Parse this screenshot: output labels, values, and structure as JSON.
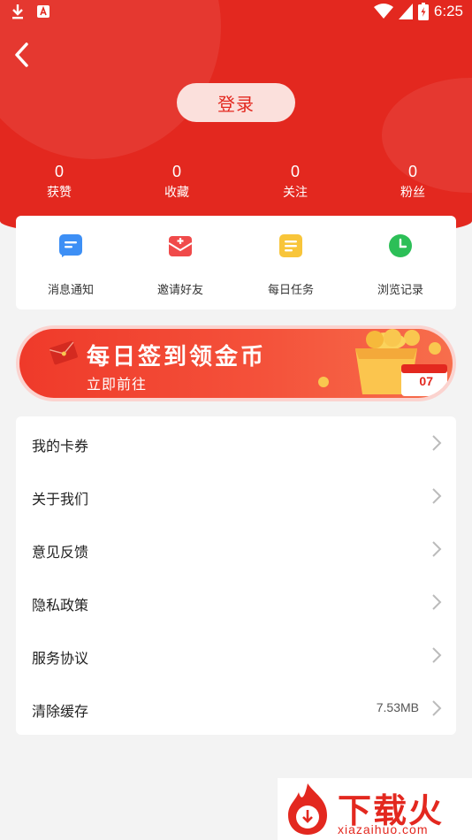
{
  "statusbar": {
    "time": "6:25"
  },
  "header": {
    "login_label": "登录"
  },
  "stats": [
    {
      "value": "0",
      "label": "获赞"
    },
    {
      "value": "0",
      "label": "收藏"
    },
    {
      "value": "0",
      "label": "关注"
    },
    {
      "value": "0",
      "label": "粉丝"
    }
  ],
  "quick_actions": [
    {
      "label": "消息通知",
      "icon": "message-icon",
      "color": "#3d8ff5"
    },
    {
      "label": "邀请好友",
      "icon": "invite-envelope-icon",
      "color": "#f04a4a"
    },
    {
      "label": "每日任务",
      "icon": "task-list-icon",
      "color": "#f8c53a"
    },
    {
      "label": "浏览记录",
      "icon": "clock-icon",
      "color": "#2cbf57"
    }
  ],
  "banner": {
    "title": "每日签到领金币",
    "subtitle": "立即前往",
    "calendar_day": "07"
  },
  "menu": [
    {
      "label": "我的卡券",
      "value": ""
    },
    {
      "label": "关于我们",
      "value": ""
    },
    {
      "label": "意见反馈",
      "value": ""
    },
    {
      "label": "隐私政策",
      "value": ""
    },
    {
      "label": "服务协议",
      "value": ""
    },
    {
      "label": "清除缓存",
      "value": "7.53MB"
    }
  ],
  "watermark": {
    "brand": "下载火",
    "domain": "xiazaihuo.com"
  },
  "colors": {
    "primary_red": "#e3281f",
    "background": "#f3f3f3"
  }
}
